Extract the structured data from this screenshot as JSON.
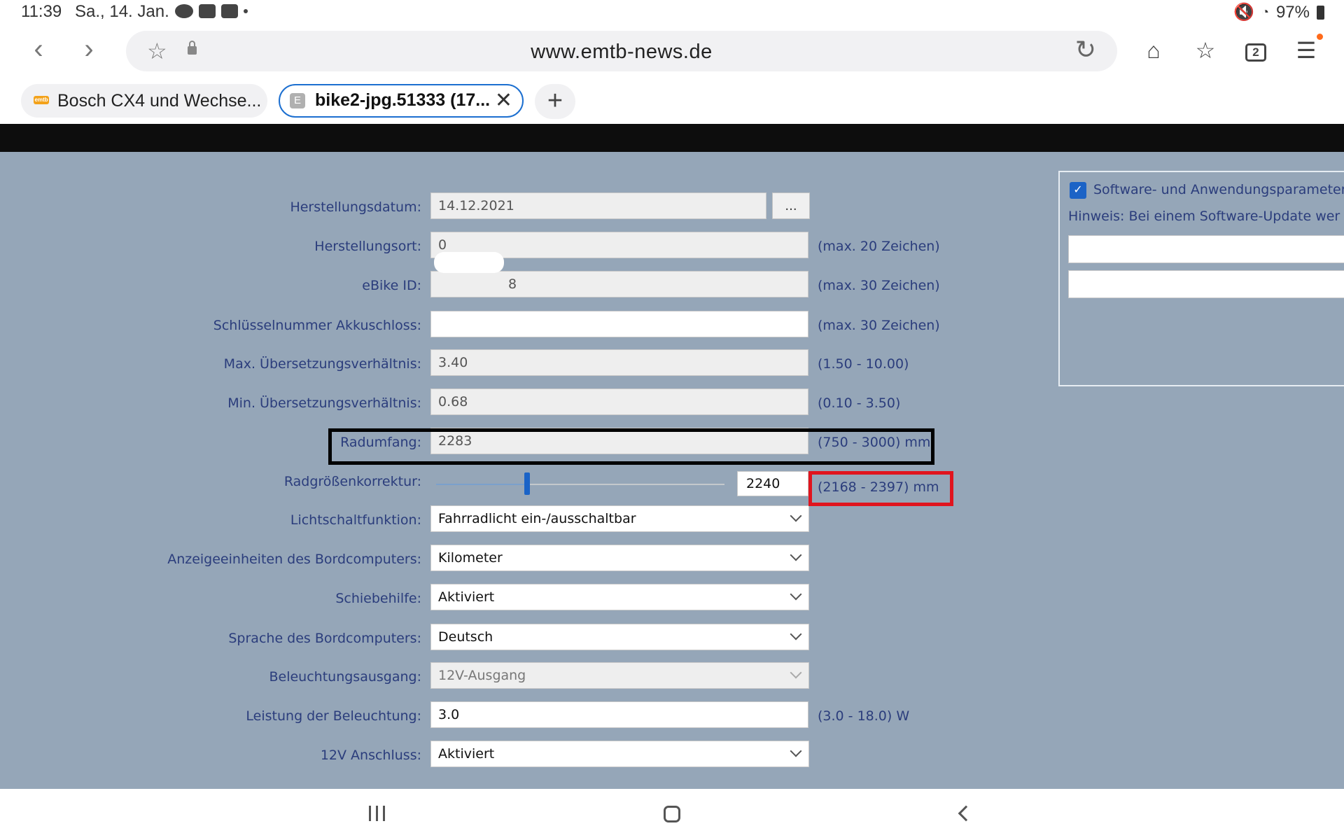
{
  "status_bar": {
    "time": "11:39",
    "date": "Sa., 14. Jan.",
    "battery": "97%"
  },
  "browser": {
    "url": "www.emtb-news.de",
    "tabs_count": "2",
    "tabs": [
      {
        "title": "Bosch CX4 und Wechse...",
        "favicon": "emtb",
        "active": false
      },
      {
        "title": "bike2-jpg.51333 (17...",
        "favicon": "E",
        "active": true
      }
    ],
    "new_tab_label": "+",
    "close_tab_label": "✕"
  },
  "form": {
    "fields": [
      {
        "label": "Herstellungsdatum:",
        "value": "14.12.2021",
        "hint": "",
        "button": "..."
      },
      {
        "label": "Herstellungsort:",
        "value": "0",
        "hint": "(max. 20 Zeichen)"
      },
      {
        "label": "eBike ID:",
        "value": "8",
        "hint": "(max. 30 Zeichen)"
      },
      {
        "label": "Schlüsselnummer Akkuschloss:",
        "value": "",
        "hint": "(max. 30 Zeichen)"
      },
      {
        "label": "Max. Übersetzungsverhältnis:",
        "value": "3.40",
        "hint": "(1.50 - 10.00)"
      },
      {
        "label": "Min. Übersetzungsverhältnis:",
        "value": "0.68",
        "hint": "(0.10 - 3.50)"
      },
      {
        "label": "Radumfang:",
        "value": "2283",
        "hint": "(750 - 3000) mm"
      },
      {
        "label": "Radgrößenkorrektur:",
        "value": "2240",
        "hint": "(2168 - 2397) mm",
        "slider_min": 2168,
        "slider_max": 2397,
        "slider_value": 2240
      },
      {
        "label": "Lichtschaltfunktion:",
        "value": "Fahrradlicht ein-/ausschaltbar"
      },
      {
        "label": "Anzeigeeinheiten des Bordcomputers:",
        "value": "Kilometer"
      },
      {
        "label": "Schiebehilfe:",
        "value": "Aktiviert"
      },
      {
        "label": "Sprache des Bordcomputers:",
        "value": "Deutsch"
      },
      {
        "label": "Beleuchtungsausgang:",
        "value": "12V-Ausgang"
      },
      {
        "label": "Leistung der Beleuchtung:",
        "value": "3.0",
        "hint": "(3.0 - 18.0) W"
      },
      {
        "label": "12V Anschluss:",
        "value": "Aktiviert"
      }
    ]
  },
  "side_panel": {
    "checkbox_label": "Software- und Anwendungsparameter",
    "note": "Hinweis: Bei einem Software-Update wer"
  },
  "colors": {
    "page_background": "#95a6b8",
    "label_text": "#2b3d7c",
    "highlight_red": "#e0141e",
    "highlight_black": "#000000",
    "tab_active_border": "#1c6fd0"
  }
}
